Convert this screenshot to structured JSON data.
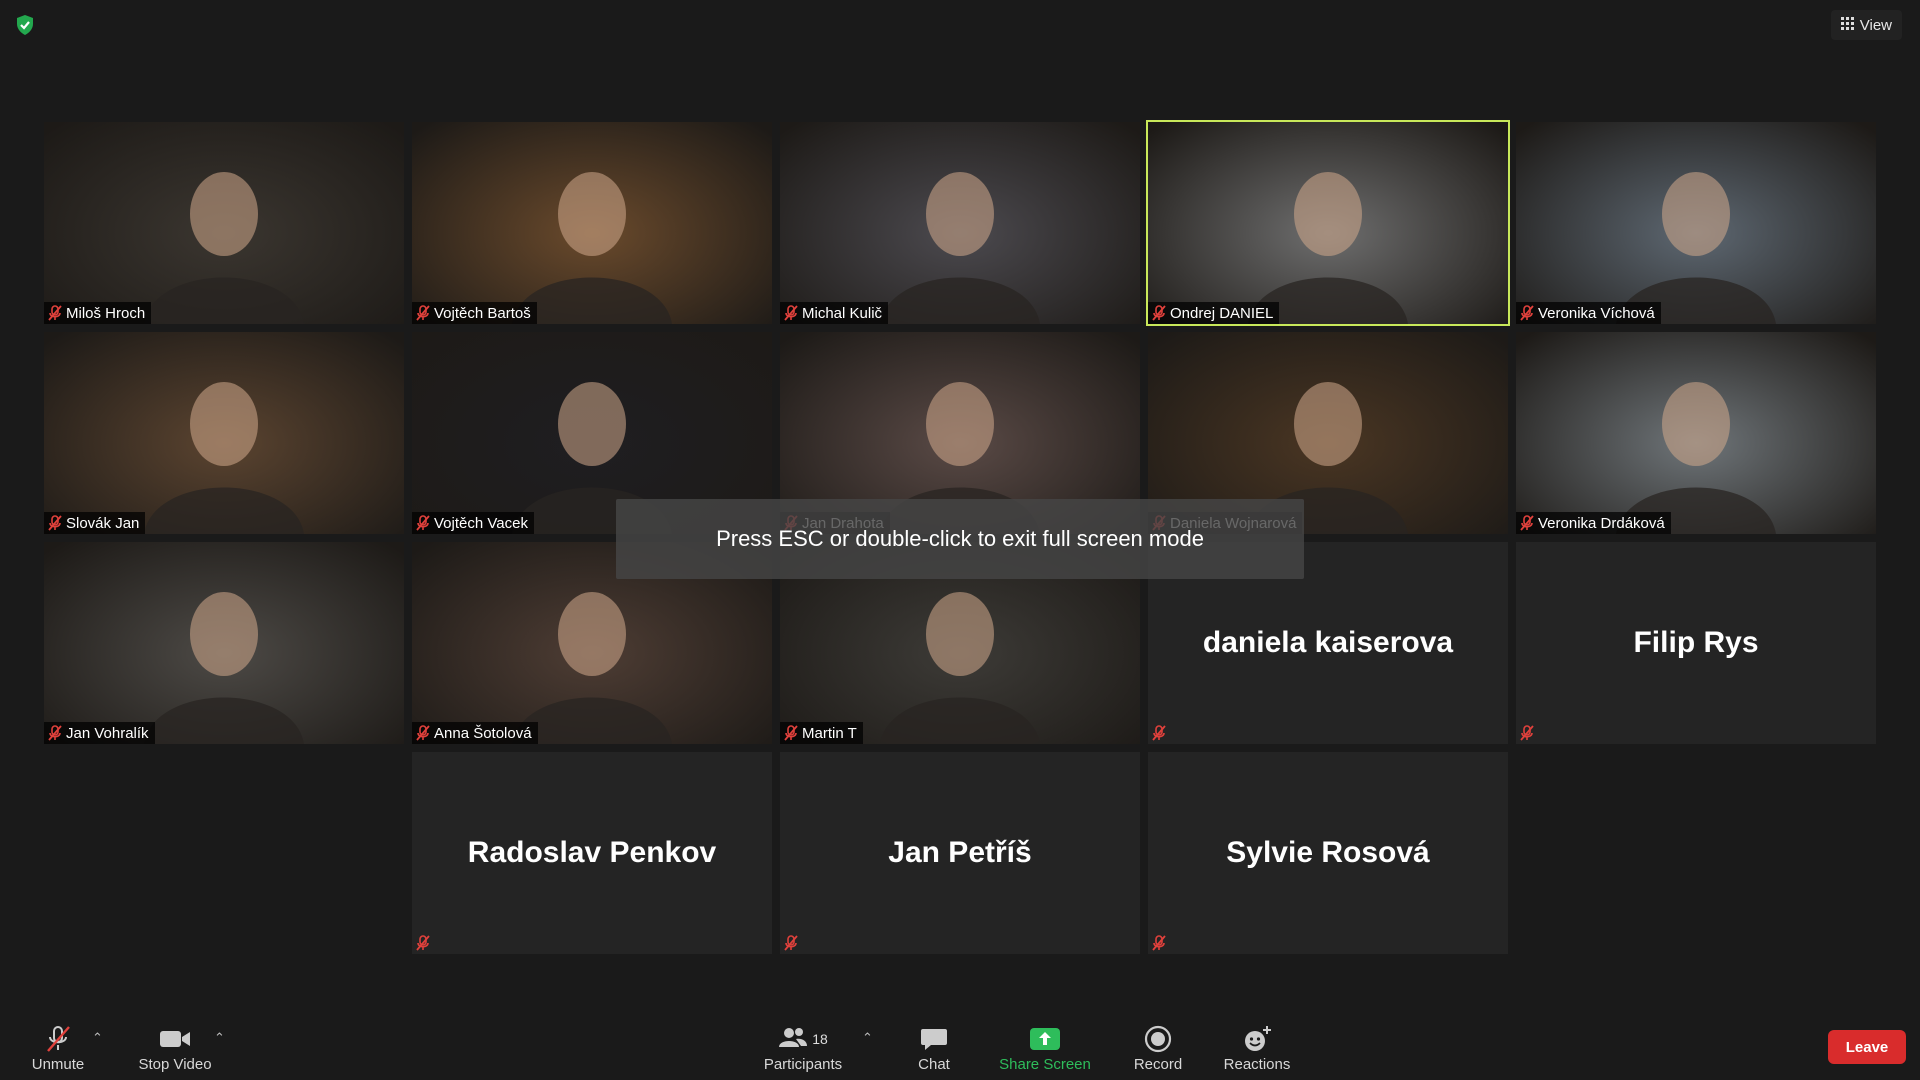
{
  "header": {
    "view_label": "View"
  },
  "banner": {
    "text": "Press ESC or double-click to exit full screen mode"
  },
  "participants": [
    {
      "name": "Miloš Hroch",
      "video": true,
      "tone": "#3b3630"
    },
    {
      "name": "Vojtěch Bartoš",
      "video": true,
      "tone": "#6a4a2c"
    },
    {
      "name": "Michal Kulič",
      "video": true,
      "tone": "#4c4a4f"
    },
    {
      "name": "Ondrej DANIEL",
      "video": true,
      "tone": "#6e6e6e",
      "active": true
    },
    {
      "name": "Veronika Víchová",
      "video": true,
      "tone": "#5e6872"
    },
    {
      "name": "Slovák Jan",
      "video": true,
      "tone": "#5b4430"
    },
    {
      "name": "Vojtěch Vacek",
      "video": true,
      "tone": "#1f1e21"
    },
    {
      "name": "Jan Drahota",
      "video": true,
      "tone": "#5a4a46"
    },
    {
      "name": "Daniela Wojnarová",
      "video": true,
      "tone": "#4a3623"
    },
    {
      "name": "Veronika Drdáková",
      "video": true,
      "tone": "#6f7579"
    },
    {
      "name": "Jan Vohralík",
      "video": true,
      "tone": "#4d4a46"
    },
    {
      "name": "Anna Šotolová",
      "video": true,
      "tone": "#4e3d34"
    },
    {
      "name": "Martin T",
      "video": true,
      "tone": "#3d3b37"
    },
    {
      "name": "daniela kaiserova",
      "video": false
    },
    {
      "name": "Filip Rys",
      "video": false
    },
    {
      "name": "Radoslav Penkov",
      "video": false
    },
    {
      "name": "Jan Petříš",
      "video": false
    },
    {
      "name": "Sylvie Rosová",
      "video": false
    }
  ],
  "toolbar": {
    "unmute": "Unmute",
    "stop_video": "Stop Video",
    "participants": "Participants",
    "participants_count": "18",
    "chat": "Chat",
    "share_screen": "Share Screen",
    "record": "Record",
    "reactions": "Reactions",
    "leave": "Leave"
  },
  "colors": {
    "active_speaker": "#c8e85a",
    "share_green": "#2ebd5b",
    "leave_red": "#d92c2c",
    "muted_red": "#e0413c"
  },
  "icons": {
    "security": "shield-check-icon",
    "view": "grid-icon",
    "muted": "mic-off-icon"
  }
}
